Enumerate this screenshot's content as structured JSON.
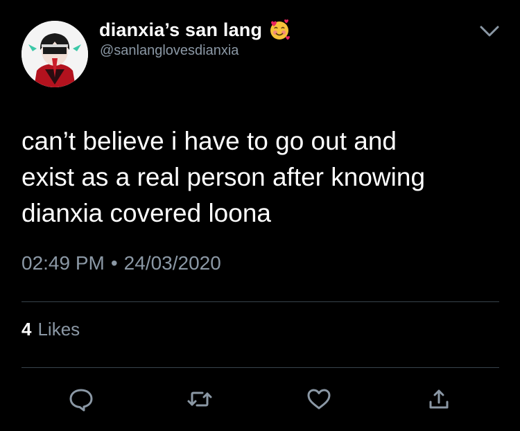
{
  "tweet": {
    "display_name": "dianxia’s san lang",
    "name_emoji": "smiling-face-with-hearts",
    "handle": "@sanlanglovesdianxia",
    "text": "can’t believe i have to go out and\nexist as a real person after knowing\ndianxia covered loona",
    "time": "02:49 PM",
    "separator": "•",
    "date": "24/03/2020",
    "likes_count": "4",
    "likes_label": "Likes"
  },
  "actions": [
    {
      "name": "reply",
      "icon": "speech-bubble-icon"
    },
    {
      "name": "retweet",
      "icon": "retweet-arrows-icon"
    },
    {
      "name": "like",
      "icon": "heart-icon"
    },
    {
      "name": "share",
      "icon": "share-upload-icon"
    }
  ],
  "colors": {
    "background": "#000000",
    "primary_text": "#ffffff",
    "secondary_text": "#8b98a5",
    "divider": "#38444d",
    "icon": "#8b98a5"
  }
}
